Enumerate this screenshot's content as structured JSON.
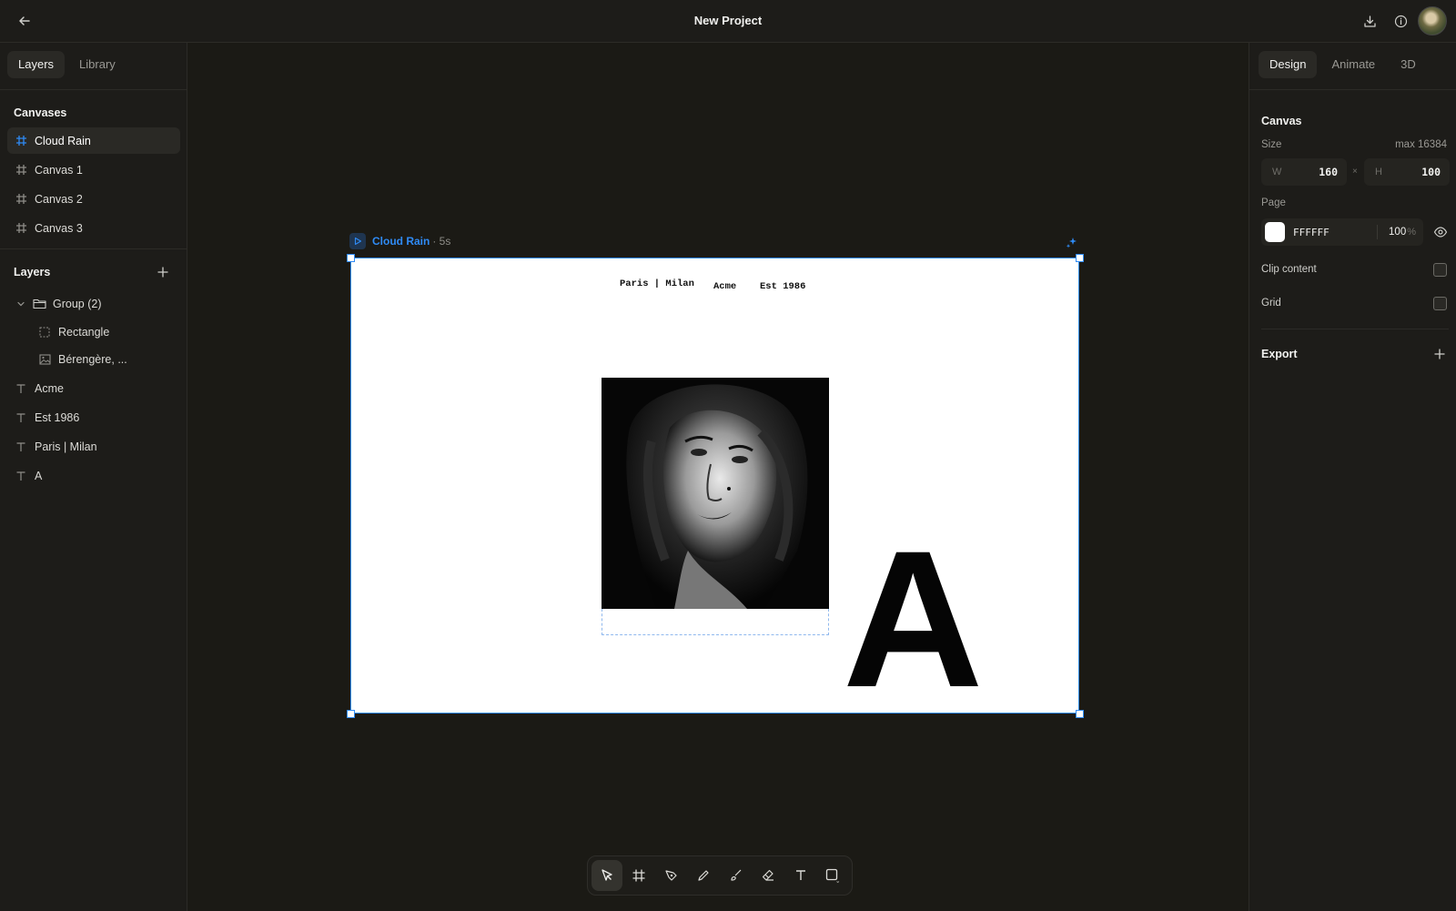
{
  "topbar": {
    "title": "New Project"
  },
  "left": {
    "tabs": [
      "Layers",
      "Library"
    ],
    "canvases_title": "Canvases",
    "canvases": [
      "Cloud Rain",
      "Canvas 1",
      "Canvas 2",
      "Canvas 3"
    ],
    "layers_title": "Layers",
    "layers": {
      "group": "Group (2)",
      "group_children": [
        "Rectangle",
        "Bérengère, ..."
      ],
      "items": [
        "Acme",
        "Est 1986",
        "Paris | Milan",
        "A"
      ]
    }
  },
  "right": {
    "tabs": [
      "Design",
      "Animate",
      "3D"
    ],
    "canvas_title": "Canvas",
    "size_label": "Size",
    "size_max": "max 16384",
    "w_label": "W",
    "w_value": "160",
    "times": "×",
    "h_label": "H",
    "h_value": "100",
    "page_label": "Page",
    "page_color": "FFFFFF",
    "page_opacity": "100",
    "page_opacity_unit": "%",
    "clip_label": "Clip content",
    "grid_label": "Grid",
    "export_label": "Export"
  },
  "frame": {
    "name": "Cloud Rain",
    "duration": "· 5s",
    "text_paris": "Paris | Milan",
    "text_acme": "Acme",
    "text_est": "Est 1986",
    "big_letter": "A"
  },
  "colors": {
    "accent": "#2f8bf5",
    "background": "#1b1a15",
    "panel": "#1d1c19"
  },
  "toolbar": [
    "select-tool",
    "frame-tool",
    "pen-tool",
    "pencil-tool",
    "brush-tool",
    "eraser-tool",
    "text-tool",
    "shape-tool"
  ]
}
